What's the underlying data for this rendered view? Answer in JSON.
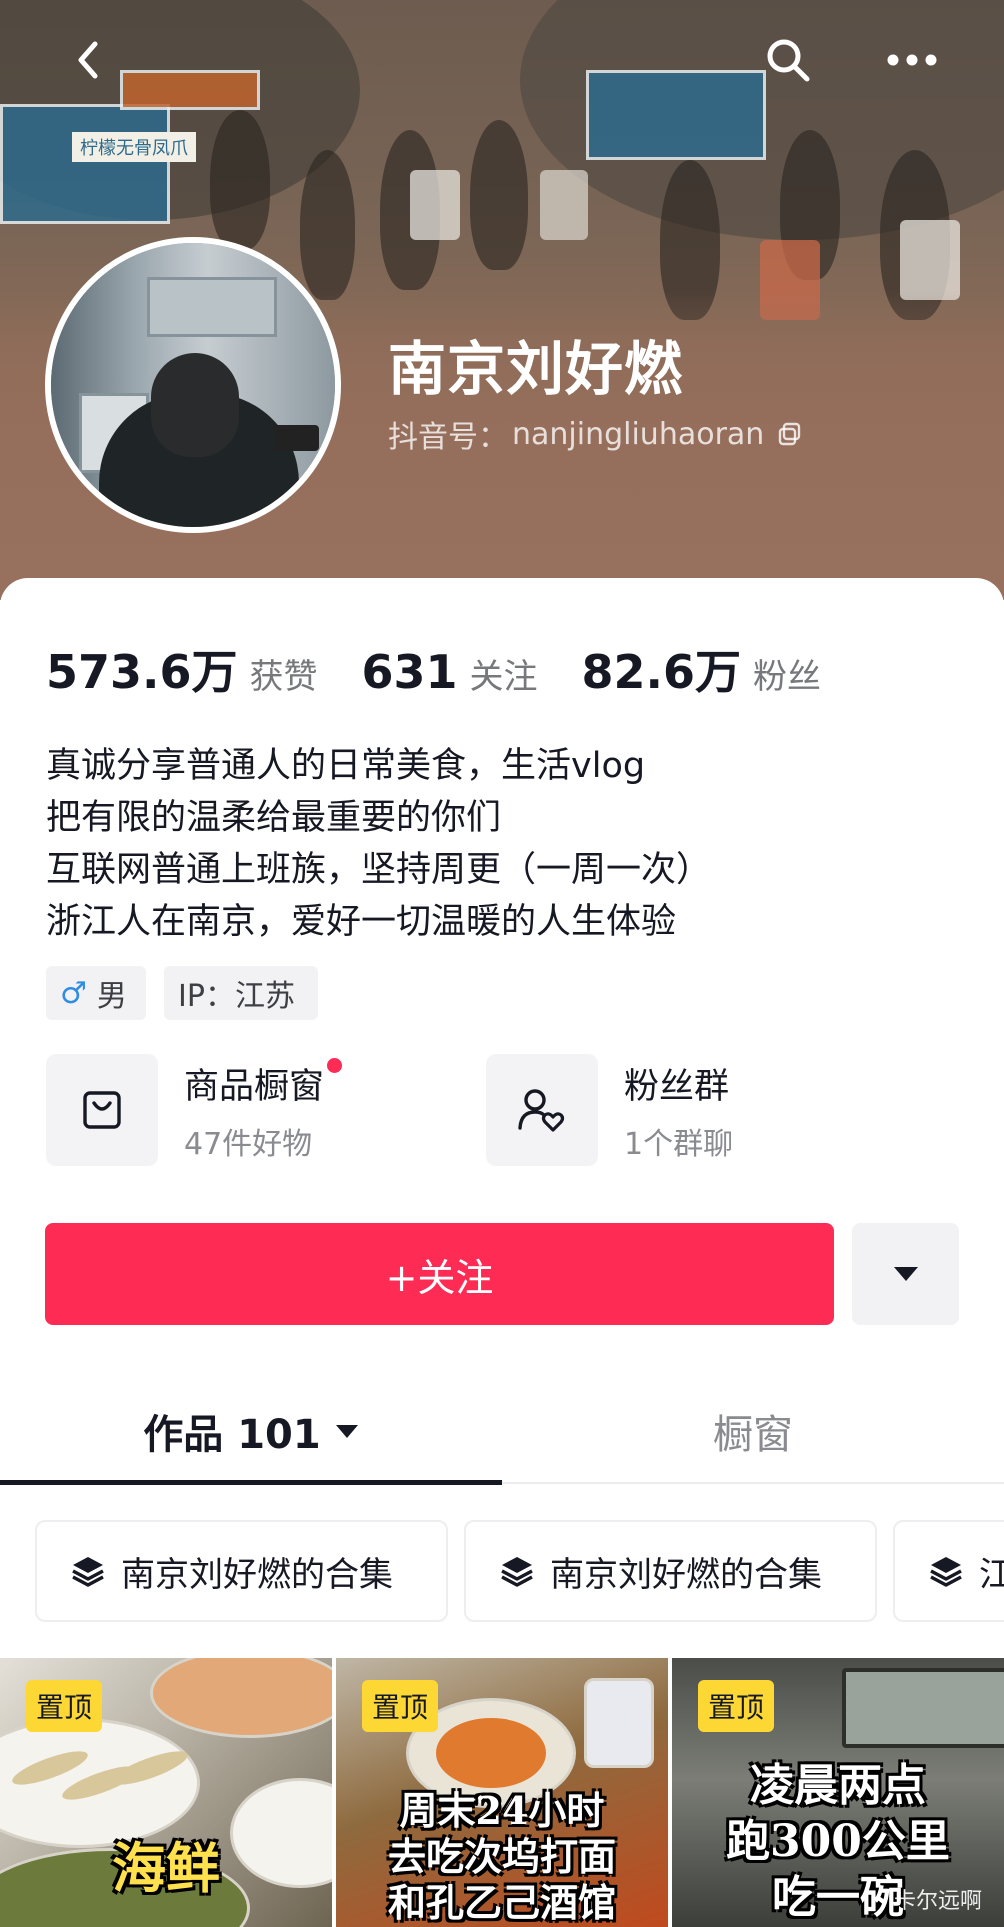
{
  "header": {
    "display_name": "南京刘好燃",
    "id_label": "抖音号：",
    "id_value": "nanjingliuhaoran",
    "stall_sign": "柠檬无骨凤爪"
  },
  "stats": [
    {
      "value": "573.6万",
      "label": "获赞"
    },
    {
      "value": "631",
      "label": "关注"
    },
    {
      "value": "82.6万",
      "label": "粉丝"
    }
  ],
  "bio": [
    "真诚分享普通人的日常美食，生活vlog",
    "把有限的温柔给最重要的你们",
    "互联网普通上班族，坚持周更（一周一次）",
    "浙江人在南京，爱好一切温暖的人生体验"
  ],
  "tags": {
    "gender_symbol": "♂",
    "gender": "男",
    "ip": "IP：江苏"
  },
  "entries": {
    "shop_title": "商品橱窗",
    "shop_sub": "47件好物",
    "fans_title": "粉丝群",
    "fans_sub": "1个群聊"
  },
  "follow_label": "+关注",
  "tabs": {
    "works": "作品 101",
    "window": "橱窗"
  },
  "collections": [
    "南京刘好燃的合集",
    "南京刘好燃的合集",
    "江"
  ],
  "videos": [
    {
      "pin": "置顶",
      "caption": "海鲜"
    },
    {
      "pin": "置顶",
      "caption_lines": [
        "周末24小时",
        "去吃次坞打面",
        "和孔乙己酒馆"
      ]
    },
    {
      "pin": "置顶",
      "caption_lines": [
        "凌晨两点",
        "跑300公里",
        "吃一碗"
      ]
    }
  ],
  "watermark": "卡尔远啊",
  "colors": {
    "accent": "#fe2c55",
    "pin_bg": "#fdd835",
    "text_primary": "#161823",
    "text_secondary": "#8a8b91"
  },
  "icons": [
    "back-icon",
    "search-icon",
    "more-icon",
    "copy-icon",
    "bag-icon",
    "fans-group-icon",
    "dropdown-icon",
    "collection-icon",
    "caret-icon"
  ]
}
